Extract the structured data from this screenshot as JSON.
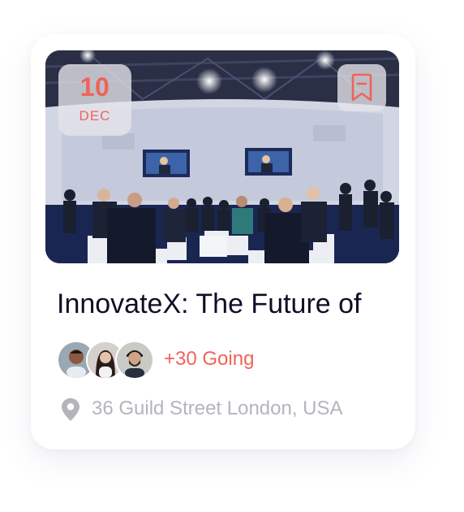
{
  "event": {
    "date_day": "10",
    "date_month": "DEC",
    "title": "InnovateX: The Future of",
    "going_label": "+30 Going",
    "address": "36 Guild Street London, USA"
  },
  "icons": {
    "bookmark": "bookmark-icon",
    "location": "location-pin-icon"
  },
  "colors": {
    "accent": "#f0635a",
    "title": "#120d26",
    "muted": "#b5b4be",
    "badge_bg": "#e6e6eb"
  }
}
